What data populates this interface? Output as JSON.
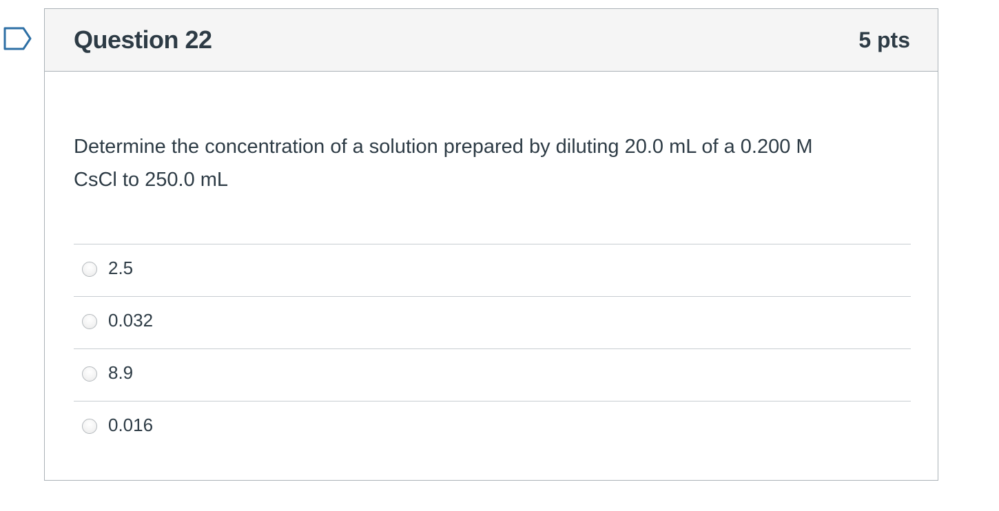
{
  "question": {
    "title": "Question 22",
    "points": "5 pts",
    "text_line1": "Determine the concentration of a solution prepared by diluting 20.0 mL of a 0.200 M",
    "text_line2": "CsCl to 250.0 mL",
    "flag_icon": "bookmark-flag-icon"
  },
  "answers": [
    {
      "label": "2.5",
      "selected": false
    },
    {
      "label": "0.032",
      "selected": false
    },
    {
      "label": "8.9",
      "selected": false
    },
    {
      "label": "0.016",
      "selected": false
    }
  ],
  "colors": {
    "text": "#2d3b45",
    "header_bg": "#f5f5f5",
    "border": "#aab1b6",
    "flag_stroke": "#2d6fa5"
  }
}
